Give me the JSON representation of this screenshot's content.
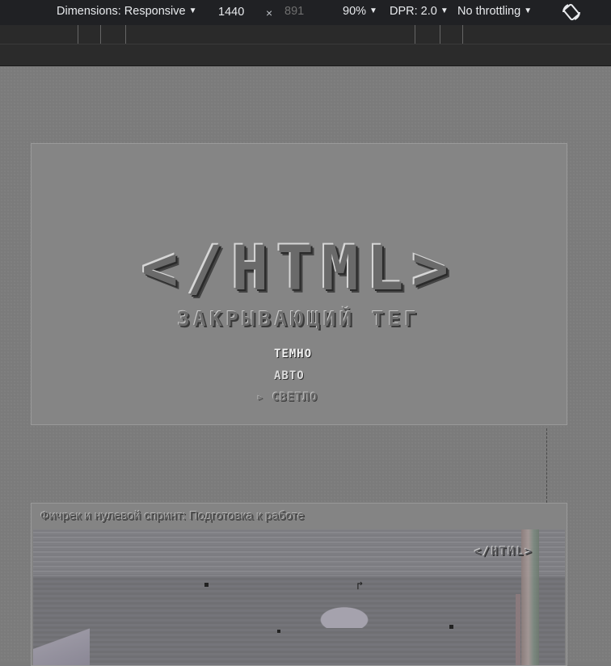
{
  "toolbar": {
    "dimensions_label": "Dimensions: Responsive",
    "width_value": "1440",
    "times_symbol": "×",
    "height_placeholder": "891",
    "zoom_label": "90%",
    "dpr_label": "DPR: 2.0",
    "throttle_label": "No throttling",
    "caret": "▼",
    "rotate_icon": "rotate-icon"
  },
  "page": {
    "logo_text": "</HTML>",
    "subtitle": "ЗАКРЫВАЮЩИЙ ТЕГ",
    "theme_options": {
      "dark": "ТЕМНО",
      "auto": "АВТО",
      "light": "▹ СВЕТЛО"
    },
    "article": {
      "title": "Фичрек и нулевой спринт: Подготовка к работе",
      "thumb_logo": "</HTML>",
      "thumb_flag": "↱"
    }
  }
}
